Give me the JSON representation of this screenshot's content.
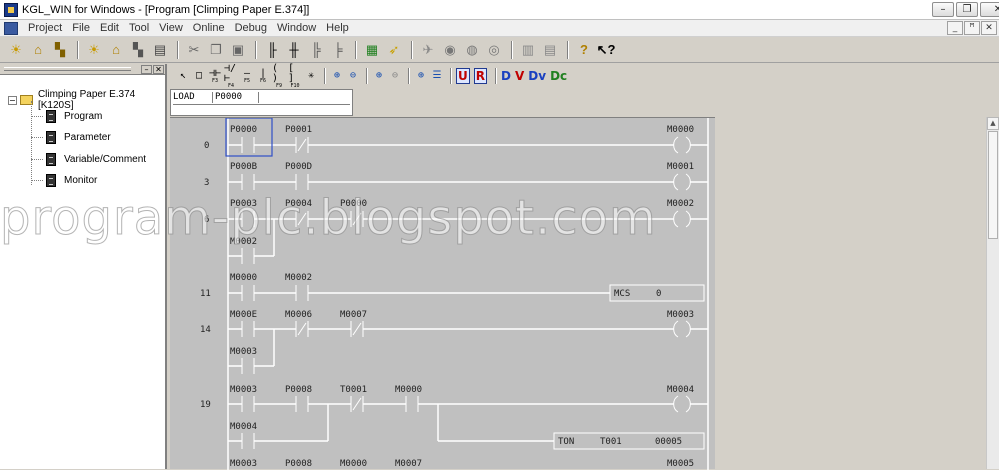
{
  "window": {
    "title": "KGL_WIN for Windows - [Program [Climping Paper E.374]]"
  },
  "window_controls": {
    "minimize": "–",
    "restore": "❐",
    "close": "✕"
  },
  "mdi_controls": {
    "minimize": "_",
    "restore": "ꟸ",
    "close": "✕"
  },
  "menu": [
    "Project",
    "File",
    "Edit",
    "Tool",
    "View",
    "Online",
    "Debug",
    "Window",
    "Help"
  ],
  "toolbar_icons": [
    "new-project-icon",
    "open-project-icon",
    "save-project-icon",
    "new-program-icon",
    "open-program-icon",
    "save-program-icon",
    "print-icon",
    "cut-icon",
    "copy-icon",
    "paste-icon",
    "ladder-view-icon",
    "instruction-list-icon",
    "variable-icon",
    "comment-icon",
    "compile-icon",
    "download-icon",
    "connect-icon",
    "run-icon",
    "stop-icon",
    "pause-icon",
    "monitor-icon",
    "reset-icon",
    "help-icon",
    "context-help-icon"
  ],
  "project_tree": {
    "root": "Climping Paper E.374 [K120S]",
    "items": [
      "Program",
      "Parameter",
      "Variable/Comment",
      "Monitor"
    ]
  },
  "editor_toolbar": {
    "tools": [
      {
        "glyph": "↖",
        "key": ""
      },
      {
        "glyph": "□",
        "key": ""
      },
      {
        "glyph": "⊣⊢",
        "key": "F3"
      },
      {
        "glyph": "⊣/⊢",
        "key": "F4"
      },
      {
        "glyph": "—",
        "key": "F5"
      },
      {
        "glyph": "|",
        "key": "F6"
      },
      {
        "glyph": "( )",
        "key": "F9"
      },
      {
        "glyph": "[ ]",
        "key": "F10"
      },
      {
        "glyph": "✳",
        "key": ""
      }
    ],
    "zoom": [
      "⊕",
      "⊖",
      "⊕",
      "⊖",
      "⊕"
    ],
    "letters": [
      "U",
      "R",
      "D",
      "V",
      "Dv",
      "Dc"
    ]
  },
  "command_line": {
    "instruction": "LOAD",
    "operand": "P0000"
  },
  "watermark": "program-plc.blogspot.com",
  "ladder": {
    "rungs": [
      {
        "step": "0",
        "labels": [
          "P0000",
          "P0001",
          "M0000"
        ]
      },
      {
        "step": "3",
        "labels": [
          "P000B",
          "P000D",
          "M0001"
        ]
      },
      {
        "step": "6",
        "labels": [
          "P0003",
          "P0004",
          "P0000",
          "M0002",
          "M0002"
        ]
      },
      {
        "step": "11",
        "labels": [
          "M0000",
          "M0002",
          "MCS",
          "0"
        ]
      },
      {
        "step": "14",
        "labels": [
          "M000E",
          "M0006",
          "M0007",
          "M0003",
          "M0003"
        ]
      },
      {
        "step": "19",
        "labels": [
          "M0003",
          "P0008",
          "T0001",
          "M0000",
          "M0004",
          "M0004",
          "TON",
          "T001",
          "00005"
        ]
      },
      {
        "step": "",
        "labels": [
          "M0003",
          "P0008",
          "M0000",
          "M0007",
          "M0005"
        ]
      }
    ]
  },
  "colors": {
    "selection": "#3050c8",
    "ladder_bg": "#c0c0c0"
  }
}
